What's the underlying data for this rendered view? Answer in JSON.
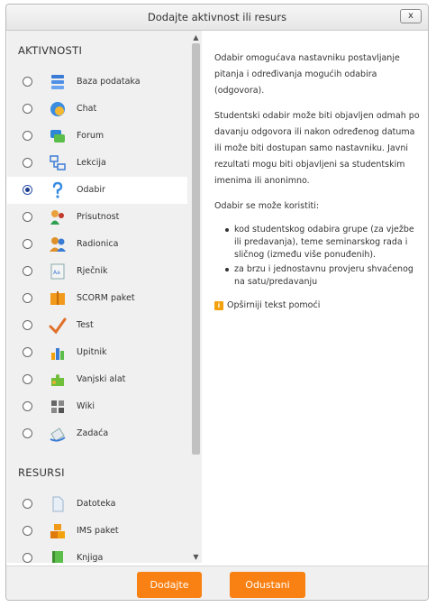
{
  "dialog": {
    "title": "Dodajte aktivnost ili resurs",
    "close_label": "x"
  },
  "sections": {
    "activities_heading": "AKTIVNOSTI",
    "resources_heading": "RESURSI"
  },
  "activities": [
    {
      "label": "Baza podataka",
      "icon": "database-icon",
      "selected": false
    },
    {
      "label": "Chat",
      "icon": "chat-icon",
      "selected": false
    },
    {
      "label": "Forum",
      "icon": "forum-icon",
      "selected": false
    },
    {
      "label": "Lekcija",
      "icon": "lesson-icon",
      "selected": false
    },
    {
      "label": "Odabir",
      "icon": "question-icon",
      "selected": true
    },
    {
      "label": "Prisutnost",
      "icon": "attendance-icon",
      "selected": false
    },
    {
      "label": "Radionica",
      "icon": "workshop-icon",
      "selected": false
    },
    {
      "label": "Rječnik",
      "icon": "glossary-icon",
      "selected": false
    },
    {
      "label": "SCORM paket",
      "icon": "scorm-icon",
      "selected": false
    },
    {
      "label": "Test",
      "icon": "quiz-icon",
      "selected": false
    },
    {
      "label": "Upitnik",
      "icon": "survey-icon",
      "selected": false
    },
    {
      "label": "Vanjski alat",
      "icon": "puzzle-icon",
      "selected": false
    },
    {
      "label": "Wiki",
      "icon": "wiki-icon",
      "selected": false
    },
    {
      "label": "Zadaća",
      "icon": "assignment-icon",
      "selected": false
    }
  ],
  "resources": [
    {
      "label": "Datoteka",
      "icon": "file-icon",
      "selected": false
    },
    {
      "label": "IMS paket",
      "icon": "ims-package-icon",
      "selected": false
    },
    {
      "label": "Knjiga",
      "icon": "book-icon",
      "selected": false
    }
  ],
  "description": {
    "paragraphs": [
      "Odabir omogućava nastavniku postavljanje pitanja i određivanja mogućih odabira (odgovora).",
      "Studentski odabir može biti objavljen odmah po davanju odgovora ili nakon određenog datuma ili može biti dostupan samo nastavniku. Javni rezultati mogu biti objavljeni sa studentskim imenima ili anonimno.",
      "Odabir se može koristiti:"
    ],
    "bullets": [
      "kod studentskog odabira grupe (za vježbe ili predavanja), teme seminarskog rada i sličnog (između više ponuđenih).",
      "za brzu i jednostavnu provjeru shvaćenog na satu/predavanju"
    ],
    "more_link": "Opširniji tekst pomoći"
  },
  "footer": {
    "add_label": "Dodajte",
    "cancel_label": "Odustani"
  },
  "colors": {
    "accent": "#f98012",
    "panel_bg": "#f0f0f0"
  }
}
